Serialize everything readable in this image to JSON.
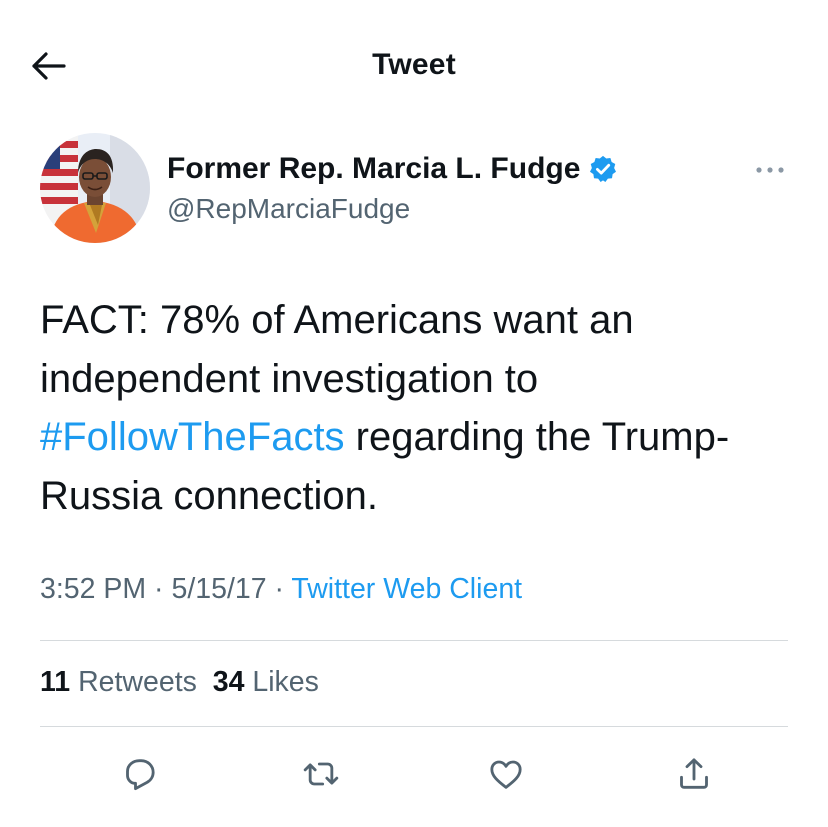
{
  "header": {
    "title": "Tweet",
    "back_icon": "arrow-left-icon"
  },
  "tweet": {
    "author": {
      "name": "Former Rep. Marcia L. Fudge",
      "handle": "@RepMarciaFudge",
      "verified": true,
      "verified_icon": "verified-badge-icon"
    },
    "text_parts": {
      "before": "FACT: 78% of Americans want an independent investigation to ",
      "hashtag": "#FollowTheFacts",
      "after": " regarding the Trump-Russia connection."
    },
    "meta": {
      "time": "3:52 PM",
      "separator": " · ",
      "date": "5/15/17",
      "client": "Twitter Web Client"
    },
    "stats": {
      "retweets_count": "11",
      "retweets_label": "Retweets",
      "likes_count": "34",
      "likes_label": "Likes"
    }
  },
  "actions": [
    {
      "name": "reply",
      "icon": "reply-icon"
    },
    {
      "name": "retweet",
      "icon": "retweet-icon"
    },
    {
      "name": "like",
      "icon": "heart-icon"
    },
    {
      "name": "share",
      "icon": "share-icon"
    }
  ],
  "colors": {
    "accent": "#1d9bf0",
    "text_primary": "#0f1419",
    "text_secondary": "#536471",
    "divider": "#d6dadd"
  }
}
